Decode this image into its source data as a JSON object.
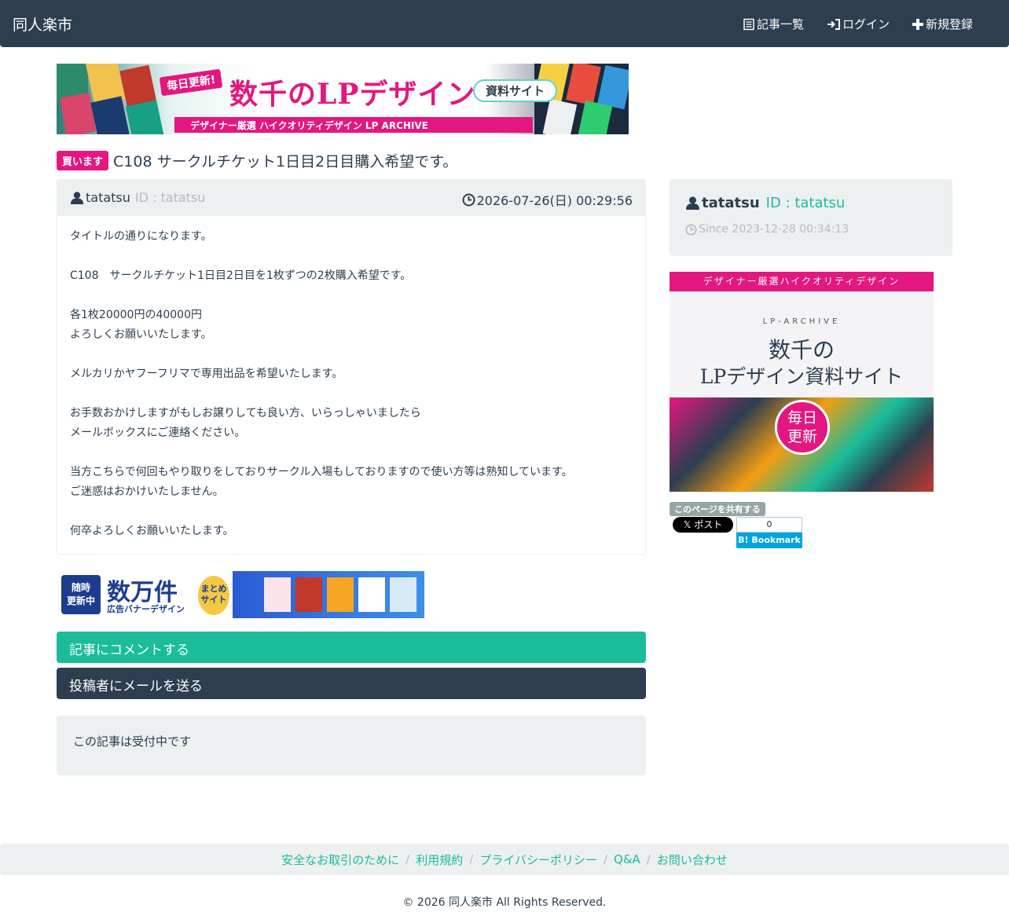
{
  "navbar": {
    "brand": "同人楽市",
    "items": [
      {
        "label": "記事一覧",
        "icon": "list-icon"
      },
      {
        "label": "ログイン",
        "icon": "login-icon"
      },
      {
        "label": "新規登録",
        "icon": "plus-icon"
      }
    ]
  },
  "top_banner": {
    "daily": "毎日更新!",
    "main": "数千のLPデザイン",
    "pill": "資料サイト",
    "strip": "デザイナー厳選 ハイクオリティデザイン LP ARCHIVE"
  },
  "post": {
    "badge": "買います",
    "title": "C108 サークルチケット1日目2日目購入希望です。",
    "user": "tatatsu",
    "user_id": "ID : tatatsu",
    "date": "2026-07-26(日) 00:29:56",
    "body": [
      "タイトルの通りになります。",
      "",
      "C108　サークルチケット1日目2日目を1枚ずつの2枚購入希望です。",
      "",
      "各1枚20000円の40000円",
      "よろしくお願いいたします。",
      "",
      "メルカリかヤフーフリマで専用出品を希望いたします。",
      "",
      "お手数おかけしますがもしお譲りしても良い方、いらっしゃいましたら",
      "メールボックスにご連絡ください。",
      "",
      "当方こちらで何回もやり取りをしておりサークル入場もしておりますので使い方等は熟知しています。",
      "ご迷惑はおかけいたしません。",
      "",
      "何卒よろしくお願いいたします。"
    ]
  },
  "bottom_banner": {
    "badge_line1": "随時",
    "badge_line2": "更新中",
    "title": "数万件",
    "sub": "広告バナーデザイン",
    "circle_line1": "まとめ",
    "circle_line2": "サイト"
  },
  "buttons": {
    "comment": "記事にコメントする",
    "mail": "投稿者にメールを送る"
  },
  "status": "この記事は受付中です",
  "profile": {
    "name": "tatatsu",
    "id": "ID : tatatsu",
    "since": "Since 2023-12-28 00:34:13"
  },
  "side_banner": {
    "strip": "デザイナー厳選ハイクオリティデザイン",
    "archive": "LP-ARCHIVE",
    "line1": "数千の",
    "line2": "LPデザイン資料サイト",
    "daily_line1": "毎日",
    "daily_line2": "更新"
  },
  "share": {
    "label": "このページを共有する",
    "x_post": "ポスト",
    "hb_count": "0",
    "hb_label": "Bookmark"
  },
  "footer": {
    "links": [
      "安全なお取引のために",
      "利用規約",
      "プライバシーポリシー",
      "Q&A",
      "お問い合わせ"
    ],
    "copyright": "© 2026 同人楽市 All Rights Reserved."
  },
  "colors": {
    "navbar": "#2c3e50",
    "accent": "#1abc9c",
    "badge": "#e3177f",
    "well": "#ecf0f1"
  }
}
